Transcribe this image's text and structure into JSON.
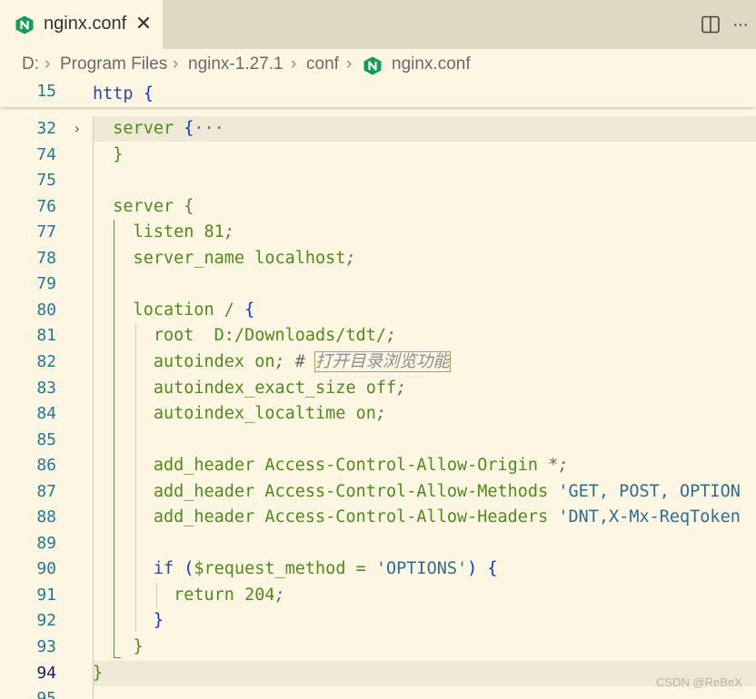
{
  "tab": {
    "label": "nginx.conf",
    "close": "✕",
    "icon_color": "#0f9d58"
  },
  "breadcrumb": {
    "drive": "D:",
    "folder1": "Program Files",
    "folder2": "nginx-1.27.1",
    "folder3": "conf",
    "file": "nginx.conf",
    "sep": "›"
  },
  "actions": {
    "more": "···"
  },
  "editor": {
    "sticky": {
      "num": "15",
      "kw": "http",
      "brace": "{"
    },
    "lines": [
      {
        "num": "32",
        "parts": [
          {
            "t": "  server ",
            "c": "kw-green"
          },
          {
            "t": "{",
            "c": "brace"
          },
          {
            "t": "···",
            "c": "punc"
          }
        ]
      },
      {
        "num": "74",
        "parts": [
          {
            "t": "  }",
            "c": "kw-green"
          }
        ]
      },
      {
        "num": "75",
        "parts": []
      },
      {
        "num": "76",
        "parts": [
          {
            "t": "  server ",
            "c": "kw-green"
          },
          {
            "t": "{",
            "c": "kw-green"
          }
        ]
      },
      {
        "num": "77",
        "parts": [
          {
            "t": "    listen ",
            "c": "kw-green"
          },
          {
            "t": "81",
            "c": "kw-green"
          },
          {
            "t": ";",
            "c": "punc"
          }
        ]
      },
      {
        "num": "78",
        "parts": [
          {
            "t": "    server_name localhost",
            "c": "kw-green"
          },
          {
            "t": ";",
            "c": "punc"
          }
        ]
      },
      {
        "num": "79",
        "parts": []
      },
      {
        "num": "80",
        "parts": [
          {
            "t": "    location / ",
            "c": "kw-green"
          },
          {
            "t": "{",
            "c": "brace"
          }
        ]
      },
      {
        "num": "81",
        "parts": [
          {
            "t": "      root  D:/Downloads/tdt/",
            "c": "kw-green"
          },
          {
            "t": ";",
            "c": "punc"
          }
        ]
      },
      {
        "num": "82",
        "parts": [
          {
            "t": "      autoindex on",
            "c": "kw-green"
          },
          {
            "t": "; # ",
            "c": "punc"
          },
          {
            "t": "打开目录浏览功能",
            "c": "comment comment-box"
          }
        ]
      },
      {
        "num": "83",
        "parts": [
          {
            "t": "      autoindex_exact_size off",
            "c": "kw-green"
          },
          {
            "t": ";",
            "c": "punc"
          }
        ]
      },
      {
        "num": "84",
        "parts": [
          {
            "t": "      autoindex_localtime on",
            "c": "kw-green"
          },
          {
            "t": ";",
            "c": "punc"
          }
        ]
      },
      {
        "num": "85",
        "parts": []
      },
      {
        "num": "86",
        "parts": [
          {
            "t": "      add_header Access-Control-Allow-Origin ",
            "c": "kw-green"
          },
          {
            "t": "*;",
            "c": "punc"
          }
        ]
      },
      {
        "num": "87",
        "parts": [
          {
            "t": "      add_header Access-Control-Allow-Methods ",
            "c": "kw-green"
          },
          {
            "t": "'GET, POST, OPTION",
            "c": "str"
          }
        ]
      },
      {
        "num": "88",
        "parts": [
          {
            "t": "      add_header Access-Control-Allow-Headers ",
            "c": "kw-green"
          },
          {
            "t": "'DNT,X-Mx-ReqToken",
            "c": "str"
          }
        ]
      },
      {
        "num": "89",
        "parts": []
      },
      {
        "num": "90",
        "parts": [
          {
            "t": "      if ",
            "c": "kw-blue"
          },
          {
            "t": "(",
            "c": "brace"
          },
          {
            "t": "$request_method = ",
            "c": "kw-green"
          },
          {
            "t": "'OPTIONS'",
            "c": "str"
          },
          {
            "t": ") {",
            "c": "brace"
          }
        ]
      },
      {
        "num": "91",
        "parts": [
          {
            "t": "        return 204",
            "c": "kw-green"
          },
          {
            "t": ";",
            "c": "punc"
          }
        ]
      },
      {
        "num": "92",
        "parts": [
          {
            "t": "      }",
            "c": "brace"
          }
        ]
      },
      {
        "num": "93",
        "parts": [
          {
            "t": "    }",
            "c": "kw-green"
          }
        ]
      },
      {
        "num": "94",
        "parts": [
          {
            "t": "}",
            "c": "kw-green"
          }
        ]
      },
      {
        "num": "95",
        "parts": []
      }
    ]
  },
  "watermark": "CSDN @ReBeX"
}
